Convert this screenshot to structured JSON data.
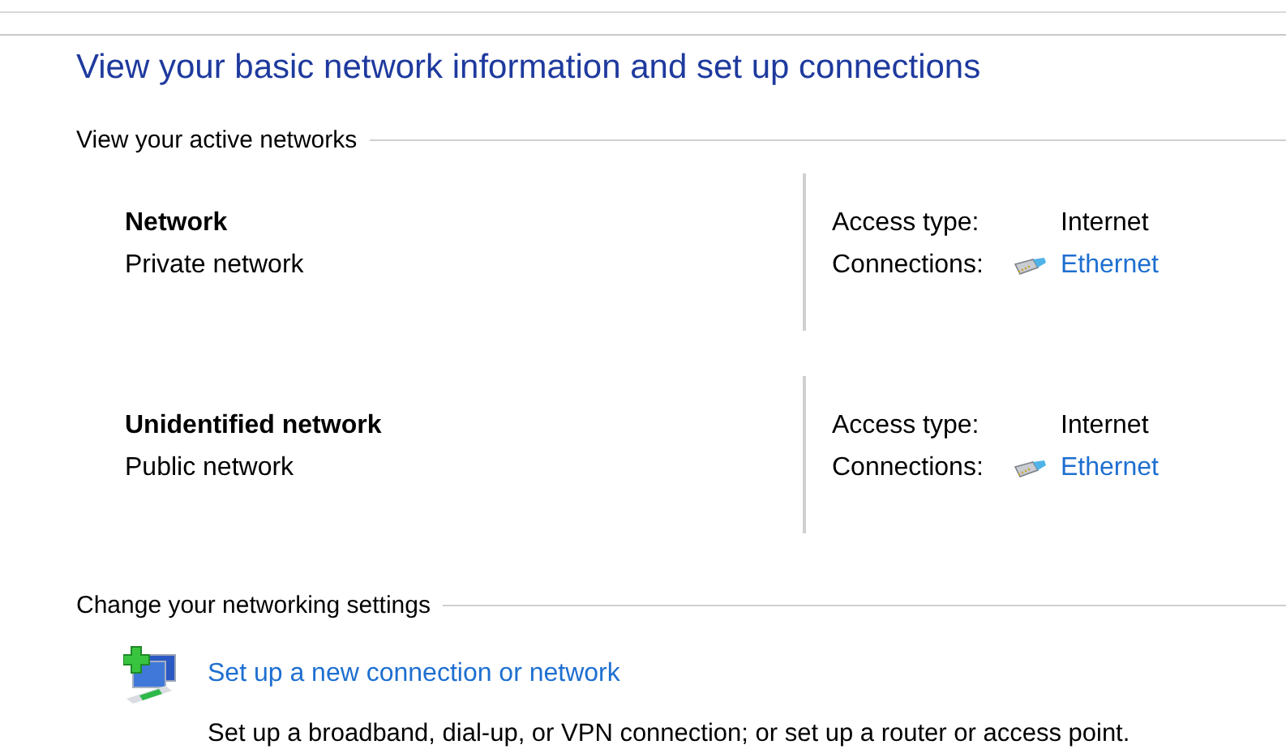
{
  "title": "View your basic network information and set up connections",
  "active_networks": {
    "heading": "View your active networks",
    "networks": [
      {
        "name": "Network",
        "category": "Private network",
        "access_label": "Access type:",
        "access_value": "Internet",
        "connections_label": "Connections:",
        "connection": "Ethernet"
      },
      {
        "name": "Unidentified network",
        "category": "Public network",
        "access_label": "Access type:",
        "access_value": "Internet",
        "connections_label": "Connections:",
        "connection": "Ethernet"
      }
    ]
  },
  "settings": {
    "heading": "Change your networking settings",
    "tasks": [
      {
        "link": "Set up a new connection or network",
        "description": "Set up a broadband, dial-up, or VPN connection; or set up a router or access point."
      }
    ]
  }
}
